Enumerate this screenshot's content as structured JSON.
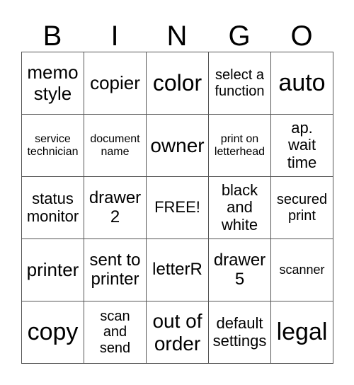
{
  "header": [
    "B",
    "I",
    "N",
    "G",
    "O"
  ],
  "cells": [
    "memo\nstyle",
    "copier",
    "color",
    "select a\nfunction",
    "auto",
    "service\ntechnician",
    "document\nname",
    "owner",
    "print on\nletterhead",
    "ap.\nwait\ntime",
    "status\nmonitor",
    "drawer\n2",
    "FREE!",
    "black\nand\nwhite",
    "secured\nprint",
    "printer",
    "sent to\nprinter",
    "letterR",
    "drawer\n5",
    "scanner",
    "copy",
    "scan\nand\nsend",
    "out of\norder",
    "default\nsettings",
    "legal"
  ]
}
